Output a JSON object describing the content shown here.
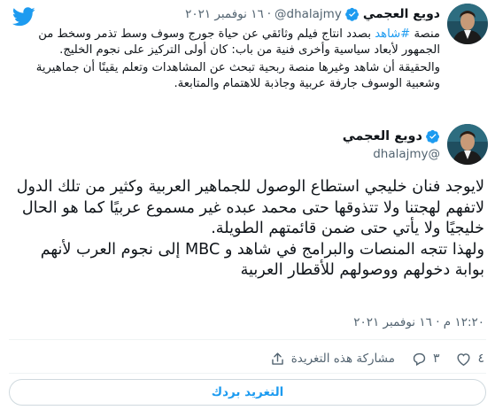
{
  "quoted_tweet": {
    "author_name": "دويع العجمي",
    "handle": "@dhalajmy",
    "separator": "·",
    "date": "١٦ نوفمبر ٢٠٢١",
    "hashtag": "#شاهد",
    "line_1_prefix": "منصة",
    "line_1_rest": "بصدد انتاج فيلم وثائقي عن حياة جورج وسوف وسط تذمر وسخط من الجمهور لأبعاد سياسية وأخرى فنية من باب: كان أولى التركيز على نجوم الخليج.",
    "paragraph_2": "والحقيقة أن شاهد وغيرها منصة ربحية تبحث عن المشاهدات وتعلم يقينًا أن جماهيرية وشعبية الوسوف جارفة عربية وجاذبة للاهتمام والمتابعة."
  },
  "main_tweet": {
    "author_name": "دويع العجمي",
    "handle": "@dhalajmy",
    "paragraph_1": "لايوجد فنان خليجي استطاع الوصول للجماهير العربية وكثير من تلك الدول لاتفهم لهجتنا ولا تتذوقها حتى محمد عبده غير مسموع عربيًا كما هو الحال خليجيًا ولا يأتي حتى ضمن قائمتهم الطويلة.",
    "paragraph_2": "ولهذا تتجه المنصات والبرامج في شاهد و MBC إلى نجوم العرب لأنهم بوابة دخولهم ووصولهم للأقطار العربية",
    "time": "١٢:٢٠ م",
    "separator": "·",
    "date": "١٦ نوفمبر ٢٠٢١"
  },
  "actions": {
    "like_count": "٤",
    "reply_count": "٣",
    "share_label": "مشاركة هذه التغريدة"
  },
  "reply_button_label": "التغريد بردك",
  "colors": {
    "accent": "#1d9bf0",
    "text": "#0f1419",
    "muted": "#536471"
  },
  "icons": {
    "logo": "twitter-bird-icon",
    "verified": "verified-badge-icon",
    "like": "heart-icon",
    "reply": "speech-bubble-icon",
    "share": "share-icon"
  }
}
